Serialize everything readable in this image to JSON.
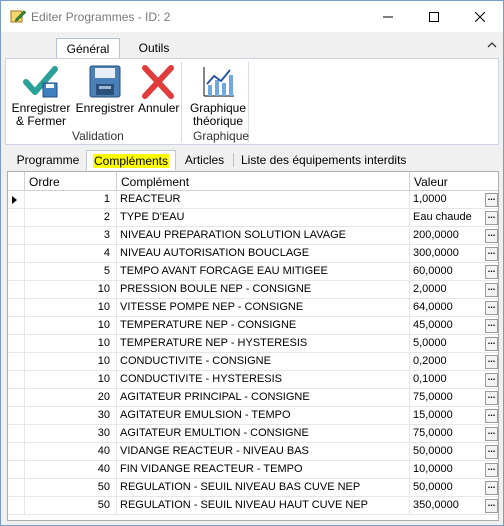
{
  "window": {
    "title": "Editer Programmes - ID: 2"
  },
  "ribbon": {
    "tabs": [
      {
        "label": "Général",
        "active": true
      },
      {
        "label": "Outils",
        "active": false
      }
    ],
    "buttons": {
      "save_close": "Enregistrer\n& Fermer",
      "save": "Enregistrer",
      "cancel": "Annuler",
      "graph": "Graphique\nthéorique"
    },
    "groups": {
      "validation": "Validation",
      "graphique": "Graphique"
    }
  },
  "content_tabs": [
    {
      "label": "Programme",
      "active": false
    },
    {
      "label": "Compléments",
      "active": true
    },
    {
      "label": "Articles",
      "active": false
    },
    {
      "label": "Liste des équipements interdits",
      "active": false
    }
  ],
  "grid": {
    "columns": {
      "ordre": "Ordre",
      "complement": "Complément",
      "valeur": "Valeur"
    },
    "button_glyph": "...",
    "rows": [
      {
        "ordre": "1",
        "complement": "REACTEUR",
        "valeur": "1,0000"
      },
      {
        "ordre": "2",
        "complement": "TYPE D'EAU",
        "valeur": "Eau chaude"
      },
      {
        "ordre": "3",
        "complement": "NIVEAU PREPARATION SOLUTION LAVAGE",
        "valeur": "200,0000"
      },
      {
        "ordre": "4",
        "complement": "NIVEAU AUTORISATION BOUCLAGE",
        "valeur": "300,0000"
      },
      {
        "ordre": "5",
        "complement": "TEMPO AVANT FORCAGE EAU MITIGEE",
        "valeur": "60,0000"
      },
      {
        "ordre": "10",
        "complement": "PRESSION BOULE NEP - CONSIGNE",
        "valeur": "2,0000"
      },
      {
        "ordre": "10",
        "complement": "VITESSE POMPE NEP - CONSIGNE",
        "valeur": "64,0000"
      },
      {
        "ordre": "10",
        "complement": "TEMPERATURE NEP - CONSIGNE",
        "valeur": "45,0000"
      },
      {
        "ordre": "10",
        "complement": "TEMPERATURE NEP - HYSTERESIS",
        "valeur": "5,0000"
      },
      {
        "ordre": "10",
        "complement": "CONDUCTIVITE - CONSIGNE",
        "valeur": "0,2000"
      },
      {
        "ordre": "10",
        "complement": "CONDUCTIVITE - HYSTERESIS",
        "valeur": "0,1000"
      },
      {
        "ordre": "20",
        "complement": "AGITATEUR PRINCIPAL - CONSIGNE",
        "valeur": "75,0000"
      },
      {
        "ordre": "30",
        "complement": "AGITATEUR EMULSION - TEMPO",
        "valeur": "15,0000"
      },
      {
        "ordre": "30",
        "complement": "AGITATEUR EMULTION - CONSIGNE",
        "valeur": "75,0000"
      },
      {
        "ordre": "40",
        "complement": "VIDANGE REACTEUR -  NIVEAU BAS",
        "valeur": "50,0000"
      },
      {
        "ordre": "40",
        "complement": "FIN VIDANGE REACTEUR - TEMPO",
        "valeur": "10,0000"
      },
      {
        "ordre": "50",
        "complement": "REGULATION - SEUIL NIVEAU BAS CUVE NEP",
        "valeur": "50,0000"
      },
      {
        "ordre": "50",
        "complement": "REGULATION - SEUIL NIVEAU HAUT CUVE NEP",
        "valeur": "350,0000"
      }
    ]
  }
}
